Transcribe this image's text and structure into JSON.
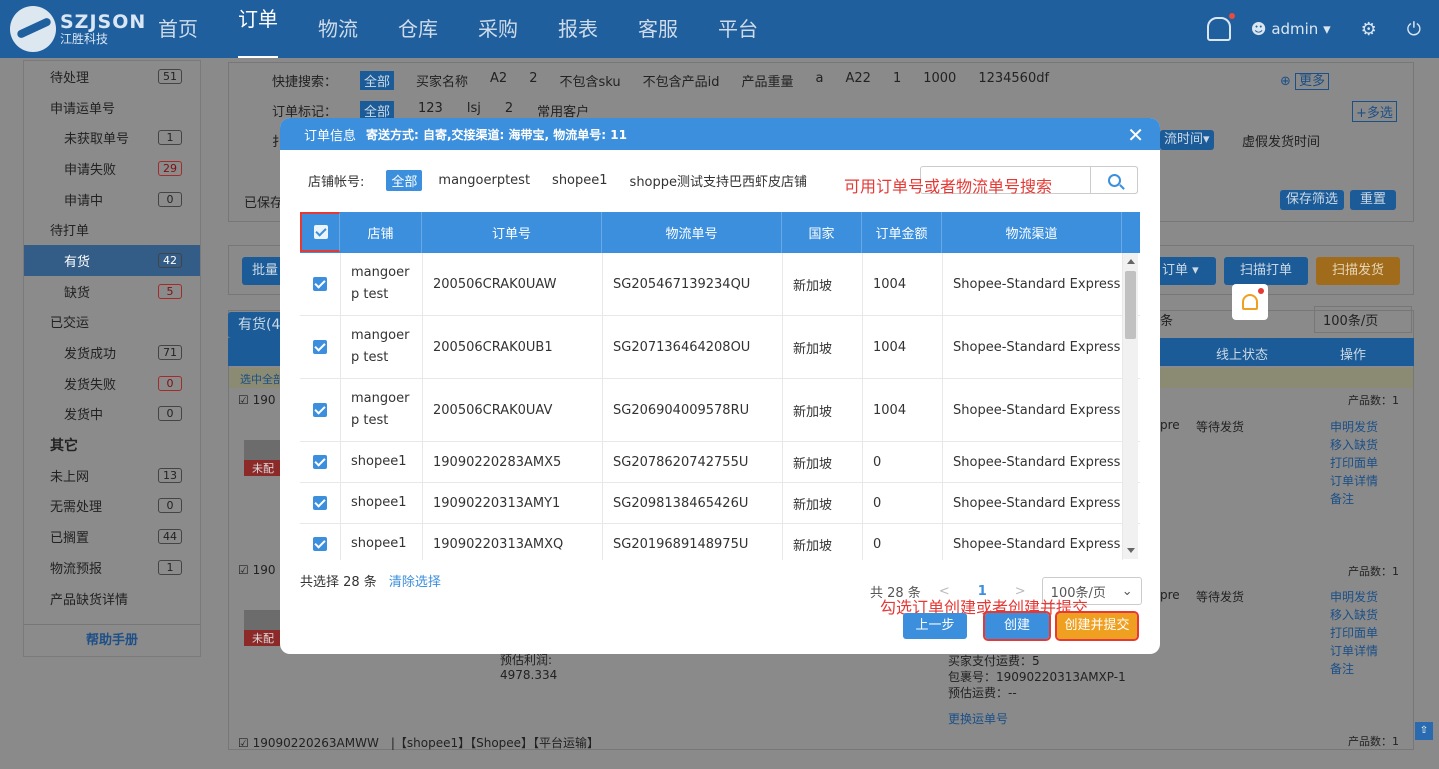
{
  "app": {
    "logo_text": "SZJSON",
    "logo_sub": "江胜科技"
  },
  "nav": [
    "首页",
    "订单",
    "物流",
    "仓库",
    "采购",
    "报表",
    "客服",
    "平台"
  ],
  "nav_active": "订单",
  "user": {
    "name": "admin ▾"
  },
  "sidebar": {
    "items": [
      {
        "label": "待处理",
        "count": "51",
        "level": "top"
      },
      {
        "label": "申请运单号",
        "count": "",
        "level": "top"
      },
      {
        "label": "未获取单号",
        "count": "1",
        "level": "sub"
      },
      {
        "label": "申请失败",
        "count": "29",
        "level": "sub",
        "red": true
      },
      {
        "label": "申请中",
        "count": "0",
        "level": "sub"
      },
      {
        "label": "待打单",
        "count": "",
        "level": "top"
      },
      {
        "label": "有货",
        "count": "42",
        "level": "sub",
        "active": true
      },
      {
        "label": "缺货",
        "count": "5",
        "level": "sub",
        "red": true
      },
      {
        "label": "已交运",
        "count": "",
        "level": "top"
      },
      {
        "label": "发货成功",
        "count": "71",
        "level": "sub"
      },
      {
        "label": "发货失败",
        "count": "0",
        "level": "sub",
        "red": true
      },
      {
        "label": "发货中",
        "count": "0",
        "level": "sub"
      },
      {
        "label": "其它",
        "count": "",
        "level": "grp"
      },
      {
        "label": "未上网",
        "count": "13",
        "level": "top"
      },
      {
        "label": "无需处理",
        "count": "0",
        "level": "top"
      },
      {
        "label": "已搁置",
        "count": "44",
        "level": "top"
      },
      {
        "label": "物流预报",
        "count": "1",
        "level": "top"
      },
      {
        "label": "产品缺货详情",
        "count": "",
        "level": "top"
      }
    ],
    "help": "帮助手册"
  },
  "background": {
    "quick_search_label": "快捷搜索：",
    "quick_search_tags": [
      "全部",
      "买家名称",
      "A2",
      "2",
      "不包含sku",
      "不包含产品id",
      "产品重量",
      "a",
      "A22",
      "1",
      "1000",
      "1234560df"
    ],
    "more": "更多",
    "order_mark_label": "订单标记：",
    "order_mark_tags": [
      "全部",
      "123",
      "lsj",
      "2",
      "常用客户"
    ],
    "multi": "+多选",
    "logistics_time": "流时间▾",
    "fake_time": "虚假发货时间",
    "saved": "已保存",
    "save_filter": "保存筛选",
    "reset": "重置",
    "batch": "批量",
    "order_btn": "订单 ▾",
    "scan_print": "扫描打单",
    "scan_ship": "扫描发货",
    "in_stock_tab": "有货(4",
    "per_page": "100条/页",
    "tiao": "条",
    "col_online_status": "线上状态",
    "col_ops": "操作",
    "select_all_hint": "选中全部",
    "product_count_1": "产品数：1",
    "product_count_2": "产品数：1",
    "product_count_3": "产品数：1",
    "wait_ship": "等待发货",
    "wait_ship2": "等待发货",
    "pre": "pre",
    "pre2": "pre",
    "ops": [
      "申明发货",
      "移入缺货",
      "打印面单",
      "订单详情",
      "备注"
    ],
    "ops2": [
      "申明发货",
      "移入缺货",
      "打印面单",
      "订单详情",
      "备注"
    ],
    "unmatched": "未配",
    "unmatched2": "未配",
    "order_prefix_1": "190",
    "order_prefix_2": "190",
    "profit_label": "预估利润:",
    "profit_value": "4978.334",
    "buyer_ship": "买家支付运费：5",
    "package_no": "包裹号：19090220313AMXP-1",
    "est_ship": "预估运费：--",
    "change_track": "更换运单号",
    "last_row": "19090220263AMWW　|【shopee1】【Shopee】【平台运输】"
  },
  "modal": {
    "title": "订单信息",
    "subtitle": "寄送方式: 自寄,交接渠道: 海带宝, 物流单号: 11",
    "shop_label": "店铺帐号:",
    "shop_all": "全部",
    "shops": [
      "mangoerptest",
      "shopee1",
      "shoppe测试支持巴西虾皮店铺"
    ],
    "search_hint": "可用订单号或者物流单号搜索",
    "columns": [
      "店铺",
      "订单号",
      "物流单号",
      "国家",
      "订单金额",
      "物流渠道"
    ],
    "rows": [
      {
        "shop": "mangoerp test",
        "order": "200506CRAK0UAW",
        "track": "SG205467139234QU",
        "country": "新加坡",
        "amount": "1004",
        "channel": "Shopee-Standard Express"
      },
      {
        "shop": "mangoerp test",
        "order": "200506CRAK0UB1",
        "track": "SG207136464208OU",
        "country": "新加坡",
        "amount": "1004",
        "channel": "Shopee-Standard Express"
      },
      {
        "shop": "mangoerp test",
        "order": "200506CRAK0UAV",
        "track": "SG206904009578RU",
        "country": "新加坡",
        "amount": "1004",
        "channel": "Shopee-Standard Express"
      },
      {
        "shop": "shopee1",
        "order": "19090220283AMX5",
        "track": "SG2078620742755U",
        "country": "新加坡",
        "amount": "0",
        "channel": "Shopee-Standard Express"
      },
      {
        "shop": "shopee1",
        "order": "19090220313AMY1",
        "track": "SG2098138465426U",
        "country": "新加坡",
        "amount": "0",
        "channel": "Shopee-Standard Express"
      },
      {
        "shop": "shopee1",
        "order": "19090220313AMXQ",
        "track": "SG2019689148975U",
        "country": "新加坡",
        "amount": "0",
        "channel": "Shopee-Standard Express"
      }
    ],
    "selected_text": "共选择 28 条",
    "clear": "清除选择",
    "total": "共 28 条",
    "page": "1",
    "per_page": "100条/页",
    "hint2": "勾选订单创建或者创建并提交",
    "prev": "上一步",
    "create": "创建",
    "create_submit": "创建并提交"
  }
}
